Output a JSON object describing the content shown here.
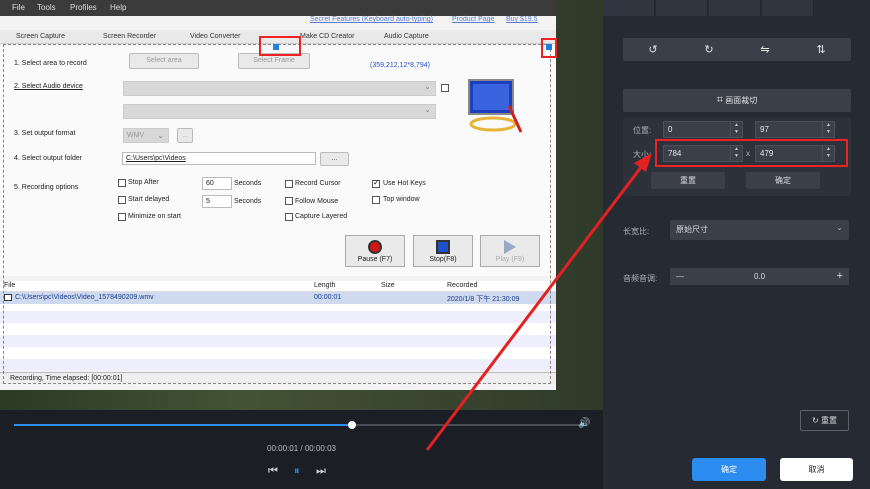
{
  "recorder": {
    "menu": [
      "File",
      "Tools",
      "Profiles",
      "Help"
    ],
    "menu_links": [
      "Secret Features (Keyboard auto-typing)",
      "Product Page",
      "Buy $19.5"
    ],
    "tabs": [
      "Screen Capture",
      "Screen Recorder",
      "Video Converter",
      "Make CD Creator",
      "Audio Capture"
    ],
    "row1_label": "1. Select area to record",
    "select_area_btn": "Select area",
    "select_frame_btn": "Select Frame",
    "coords": "(359,212,12*8,794)",
    "row2_label": "2. Select Audio device",
    "row3_label": "3. Set output format",
    "format_value": "WMV",
    "format_btn": "...",
    "row4_label": "4. Select output folder",
    "folder_value": "C:\\Users\\pc\\Videos",
    "folder_btn": "...",
    "row5_label": "5. Recording options",
    "stop_after": "Stop After",
    "stop_after_val": "60",
    "seconds1": "Seconds",
    "start_delayed": "Start delayed",
    "start_delayed_val": "5",
    "seconds2": "Seconds",
    "minimize": "Minimize on start",
    "record_cursor": "Record Cursor",
    "follow_mouse": "Follow Mouse",
    "capture_layered": "Capture Layered",
    "use_hotkeys": "Use Hot Keys",
    "top_window": "Top window",
    "pause_btn": "Pause (F7)",
    "stop_btn": "Stop(F8)",
    "play_btn": "Play (F9)",
    "table_headers": [
      "File",
      "Length",
      "Size",
      "Recorded"
    ],
    "table_row": {
      "file": "C:\\Users\\pc\\Videos\\Video_1578490209.wmv",
      "length": "00:00:01",
      "size": "",
      "recorded": "2020/1/8 下午 21:30:09"
    },
    "status": "Recording, Time elapsed: [00:00:01]"
  },
  "player": {
    "progress": 0.59,
    "time": "00:00:01 / 00:00:03",
    "prev_icon": "step-back-icon",
    "pause_icon": "pause-icon",
    "next_icon": "step-forward-icon",
    "volume_icon": "speaker-icon"
  },
  "panel": {
    "rotate_icons": [
      "rotate-left-icon",
      "rotate-right-icon",
      "flip-horizontal-icon",
      "flip-vertical-icon"
    ],
    "crop_label": "画面裁切",
    "position_label": "位置:",
    "pos_x": "0",
    "pos_y": "97",
    "size_label": "大小:",
    "width": "784",
    "height": "479",
    "times": "x",
    "reset_btn": "重置",
    "confirm_btn": "确定",
    "aspect_label": "长宽比:",
    "aspect_value": "原始尺寸",
    "volume_label": "音频音调:",
    "volume_minus": "—",
    "volume_value": "0.0",
    "volume_plus": "+",
    "reset_all_btn": "重置",
    "ok_btn": "确定",
    "cancel_btn": "取消"
  },
  "colors": {
    "accent": "#2d8cf0",
    "highlight": "#e22222"
  }
}
